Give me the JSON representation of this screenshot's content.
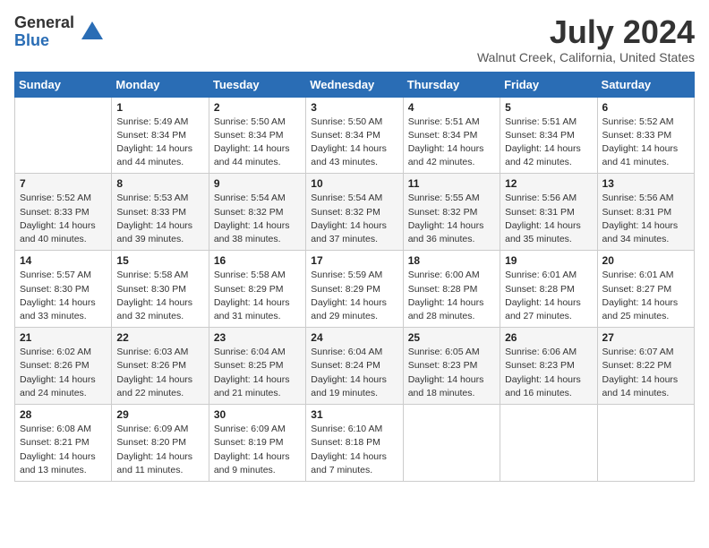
{
  "logo": {
    "general": "General",
    "blue": "Blue"
  },
  "title": {
    "month": "July 2024",
    "location": "Walnut Creek, California, United States"
  },
  "weekdays": [
    "Sunday",
    "Monday",
    "Tuesday",
    "Wednesday",
    "Thursday",
    "Friday",
    "Saturday"
  ],
  "weeks": [
    [
      {
        "day": "",
        "data": ""
      },
      {
        "day": "1",
        "data": "Sunrise: 5:49 AM\nSunset: 8:34 PM\nDaylight: 14 hours\nand 44 minutes."
      },
      {
        "day": "2",
        "data": "Sunrise: 5:50 AM\nSunset: 8:34 PM\nDaylight: 14 hours\nand 44 minutes."
      },
      {
        "day": "3",
        "data": "Sunrise: 5:50 AM\nSunset: 8:34 PM\nDaylight: 14 hours\nand 43 minutes."
      },
      {
        "day": "4",
        "data": "Sunrise: 5:51 AM\nSunset: 8:34 PM\nDaylight: 14 hours\nand 42 minutes."
      },
      {
        "day": "5",
        "data": "Sunrise: 5:51 AM\nSunset: 8:34 PM\nDaylight: 14 hours\nand 42 minutes."
      },
      {
        "day": "6",
        "data": "Sunrise: 5:52 AM\nSunset: 8:33 PM\nDaylight: 14 hours\nand 41 minutes."
      }
    ],
    [
      {
        "day": "7",
        "data": "Sunrise: 5:52 AM\nSunset: 8:33 PM\nDaylight: 14 hours\nand 40 minutes."
      },
      {
        "day": "8",
        "data": "Sunrise: 5:53 AM\nSunset: 8:33 PM\nDaylight: 14 hours\nand 39 minutes."
      },
      {
        "day": "9",
        "data": "Sunrise: 5:54 AM\nSunset: 8:32 PM\nDaylight: 14 hours\nand 38 minutes."
      },
      {
        "day": "10",
        "data": "Sunrise: 5:54 AM\nSunset: 8:32 PM\nDaylight: 14 hours\nand 37 minutes."
      },
      {
        "day": "11",
        "data": "Sunrise: 5:55 AM\nSunset: 8:32 PM\nDaylight: 14 hours\nand 36 minutes."
      },
      {
        "day": "12",
        "data": "Sunrise: 5:56 AM\nSunset: 8:31 PM\nDaylight: 14 hours\nand 35 minutes."
      },
      {
        "day": "13",
        "data": "Sunrise: 5:56 AM\nSunset: 8:31 PM\nDaylight: 14 hours\nand 34 minutes."
      }
    ],
    [
      {
        "day": "14",
        "data": "Sunrise: 5:57 AM\nSunset: 8:30 PM\nDaylight: 14 hours\nand 33 minutes."
      },
      {
        "day": "15",
        "data": "Sunrise: 5:58 AM\nSunset: 8:30 PM\nDaylight: 14 hours\nand 32 minutes."
      },
      {
        "day": "16",
        "data": "Sunrise: 5:58 AM\nSunset: 8:29 PM\nDaylight: 14 hours\nand 31 minutes."
      },
      {
        "day": "17",
        "data": "Sunrise: 5:59 AM\nSunset: 8:29 PM\nDaylight: 14 hours\nand 29 minutes."
      },
      {
        "day": "18",
        "data": "Sunrise: 6:00 AM\nSunset: 8:28 PM\nDaylight: 14 hours\nand 28 minutes."
      },
      {
        "day": "19",
        "data": "Sunrise: 6:01 AM\nSunset: 8:28 PM\nDaylight: 14 hours\nand 27 minutes."
      },
      {
        "day": "20",
        "data": "Sunrise: 6:01 AM\nSunset: 8:27 PM\nDaylight: 14 hours\nand 25 minutes."
      }
    ],
    [
      {
        "day": "21",
        "data": "Sunrise: 6:02 AM\nSunset: 8:26 PM\nDaylight: 14 hours\nand 24 minutes."
      },
      {
        "day": "22",
        "data": "Sunrise: 6:03 AM\nSunset: 8:26 PM\nDaylight: 14 hours\nand 22 minutes."
      },
      {
        "day": "23",
        "data": "Sunrise: 6:04 AM\nSunset: 8:25 PM\nDaylight: 14 hours\nand 21 minutes."
      },
      {
        "day": "24",
        "data": "Sunrise: 6:04 AM\nSunset: 8:24 PM\nDaylight: 14 hours\nand 19 minutes."
      },
      {
        "day": "25",
        "data": "Sunrise: 6:05 AM\nSunset: 8:23 PM\nDaylight: 14 hours\nand 18 minutes."
      },
      {
        "day": "26",
        "data": "Sunrise: 6:06 AM\nSunset: 8:23 PM\nDaylight: 14 hours\nand 16 minutes."
      },
      {
        "day": "27",
        "data": "Sunrise: 6:07 AM\nSunset: 8:22 PM\nDaylight: 14 hours\nand 14 minutes."
      }
    ],
    [
      {
        "day": "28",
        "data": "Sunrise: 6:08 AM\nSunset: 8:21 PM\nDaylight: 14 hours\nand 13 minutes."
      },
      {
        "day": "29",
        "data": "Sunrise: 6:09 AM\nSunset: 8:20 PM\nDaylight: 14 hours\nand 11 minutes."
      },
      {
        "day": "30",
        "data": "Sunrise: 6:09 AM\nSunset: 8:19 PM\nDaylight: 14 hours\nand 9 minutes."
      },
      {
        "day": "31",
        "data": "Sunrise: 6:10 AM\nSunset: 8:18 PM\nDaylight: 14 hours\nand 7 minutes."
      },
      {
        "day": "",
        "data": ""
      },
      {
        "day": "",
        "data": ""
      },
      {
        "day": "",
        "data": ""
      }
    ]
  ]
}
